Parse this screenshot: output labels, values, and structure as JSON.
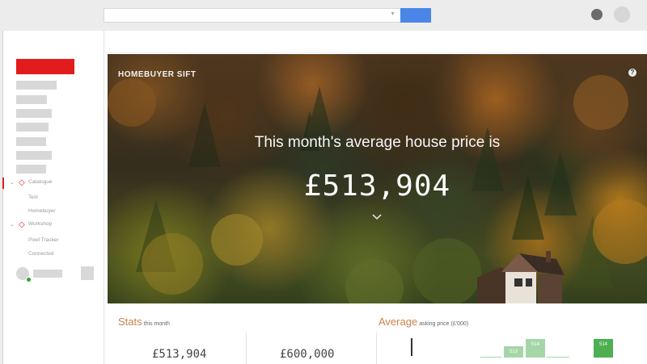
{
  "browser": {
    "search_value": "",
    "search_button_color": "#4a86e8"
  },
  "sidebar": {
    "groups": [
      {
        "label": "Catalogue",
        "icon": "diamond-logo-icon",
        "children": [
          "Test",
          "Homebuyer"
        ]
      },
      {
        "label": "Workshop",
        "icon": "diamond-logo-icon",
        "children": [
          "Pixel Tracker",
          "Connected"
        ]
      }
    ],
    "accent_color": "#e21c1c"
  },
  "hero": {
    "brand": "HOMEBUYER SIFT",
    "help_icon": "help-icon",
    "heading": "This month's average house price is",
    "price": "£513,904",
    "scroll_icon": "chevron-down-icon"
  },
  "stats": {
    "title": "Stats",
    "subtitle": "this month",
    "values": [
      "£513,904",
      "£600,000"
    ]
  },
  "average": {
    "title": "Average",
    "subtitle": "asking price (£'000)"
  },
  "chart_data": {
    "type": "bar",
    "title": "Average",
    "ylabel": "asking price (£'000)",
    "values": [
      513,
      514,
      514
    ],
    "colors": [
      "#a5d6a7",
      "#a5d6a7",
      "#4caf50"
    ]
  }
}
